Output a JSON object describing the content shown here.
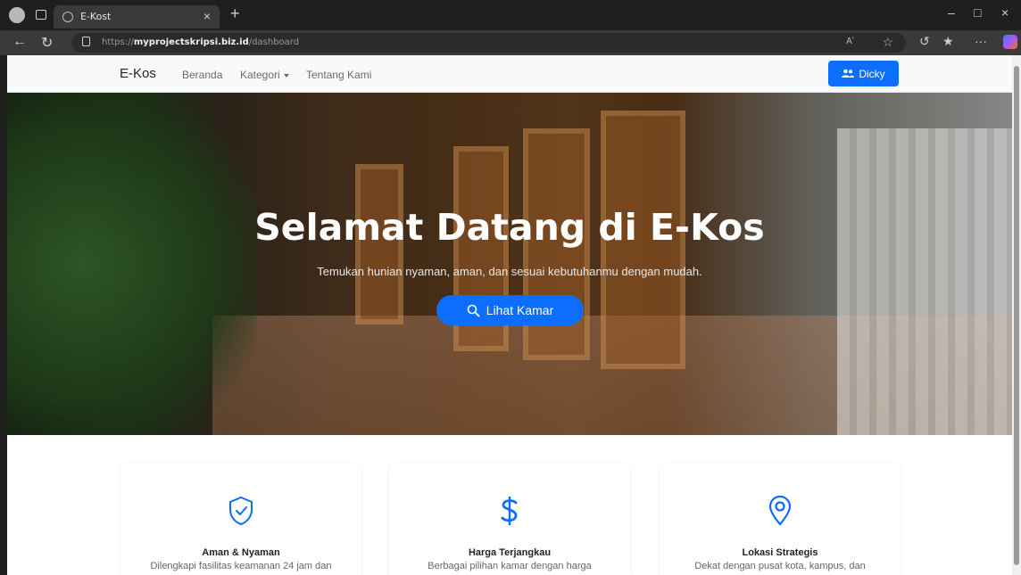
{
  "browser": {
    "tab_title": "E-Kost",
    "tab_close": "×",
    "new_tab": "+",
    "url_scheme": "https://",
    "url_host": "myprojectskripsi.biz.id",
    "url_path": "/dashboard",
    "reader_label": "Aʼ",
    "minimize": "–",
    "restore": "□",
    "close": "×",
    "more": "···"
  },
  "navbar": {
    "brand": "E-Kos",
    "links": [
      "Beranda",
      "Kategori",
      "Tentang Kami"
    ],
    "user_button": "Dicky"
  },
  "hero": {
    "title": "Selamat Datang di E-Kos",
    "subtitle": "Temukan hunian nyaman, aman, dan sesuai kebutuhanmu dengan mudah.",
    "button": "Lihat Kamar"
  },
  "features": [
    {
      "icon": "shield-check-icon",
      "title": "Aman & Nyaman",
      "desc": "Dilengkapi fasilitas keamanan 24 jam dan"
    },
    {
      "icon": "dollar-icon",
      "title": "Harga Terjangkau",
      "desc": "Berbagai pilihan kamar dengan harga"
    },
    {
      "icon": "map-pin-icon",
      "title": "Lokasi Strategis",
      "desc": "Dekat dengan pusat kota, kampus, dan"
    }
  ],
  "colors": {
    "primary": "#0d6efd",
    "navbar_bg": "#f8f9fa",
    "browser_dark": "#1f1f1f"
  }
}
